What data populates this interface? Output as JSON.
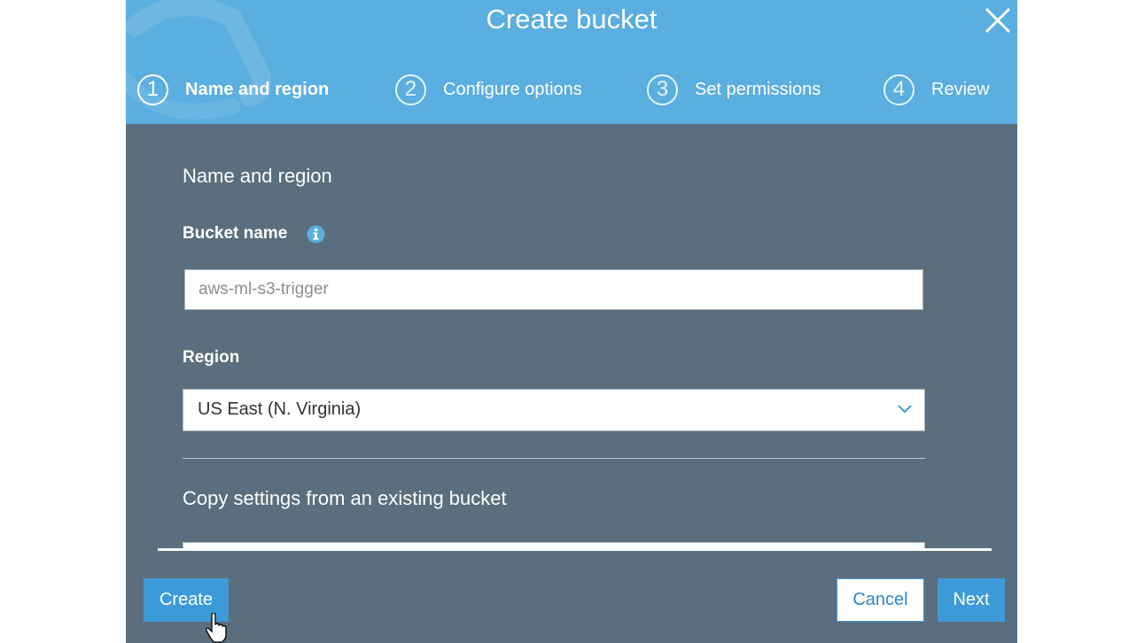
{
  "modal": {
    "title": "Create bucket",
    "colors": {
      "header": "#5aaee0",
      "body": "#5a6e7d",
      "primary_button": "#3c9ad8"
    },
    "close_icon": "close-icon"
  },
  "steps": [
    {
      "number": "1",
      "label": "Name and region",
      "active": true
    },
    {
      "number": "2",
      "label": "Configure options",
      "active": false
    },
    {
      "number": "3",
      "label": "Set permissions",
      "active": false
    },
    {
      "number": "4",
      "label": "Review",
      "active": false
    }
  ],
  "form": {
    "section_title": "Name and region",
    "bucket_name": {
      "label": "Bucket name",
      "value": "",
      "placeholder": "aws-ml-s3-trigger"
    },
    "region": {
      "label": "Region",
      "selected": "US East (N. Virginia)"
    },
    "copy_section_title": "Copy settings from an existing bucket"
  },
  "footer": {
    "create_label": "Create",
    "cancel_label": "Cancel",
    "next_label": "Next"
  }
}
